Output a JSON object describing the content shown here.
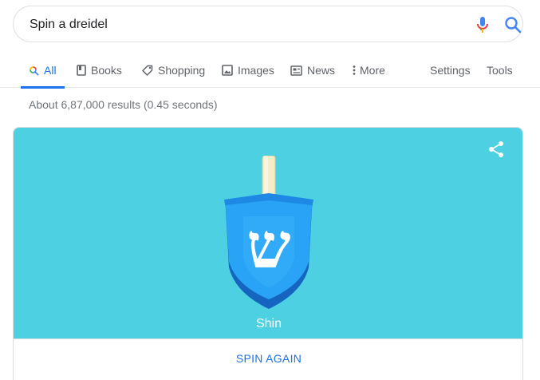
{
  "search": {
    "query": "Spin a dreidel"
  },
  "tabs": [
    {
      "label": "All",
      "icon": "search-icon"
    },
    {
      "label": "Books",
      "icon": "book-icon"
    },
    {
      "label": "Shopping",
      "icon": "tag-icon"
    },
    {
      "label": "Images",
      "icon": "image-icon"
    },
    {
      "label": "News",
      "icon": "news-icon"
    },
    {
      "label": "More",
      "icon": "more-vert-icon"
    },
    {
      "label": "Settings"
    },
    {
      "label": "Tools"
    }
  ],
  "result_stats": "About 6,87,000 results (0.45 seconds)",
  "dreidel": {
    "glyph": "ש",
    "letter_name": "Shin",
    "spin_label": "SPIN AGAIN"
  },
  "colors": {
    "accent": "#1a73e8",
    "stage_bg": "#4dd0e1",
    "dreidel_blue": "#2196f3"
  }
}
